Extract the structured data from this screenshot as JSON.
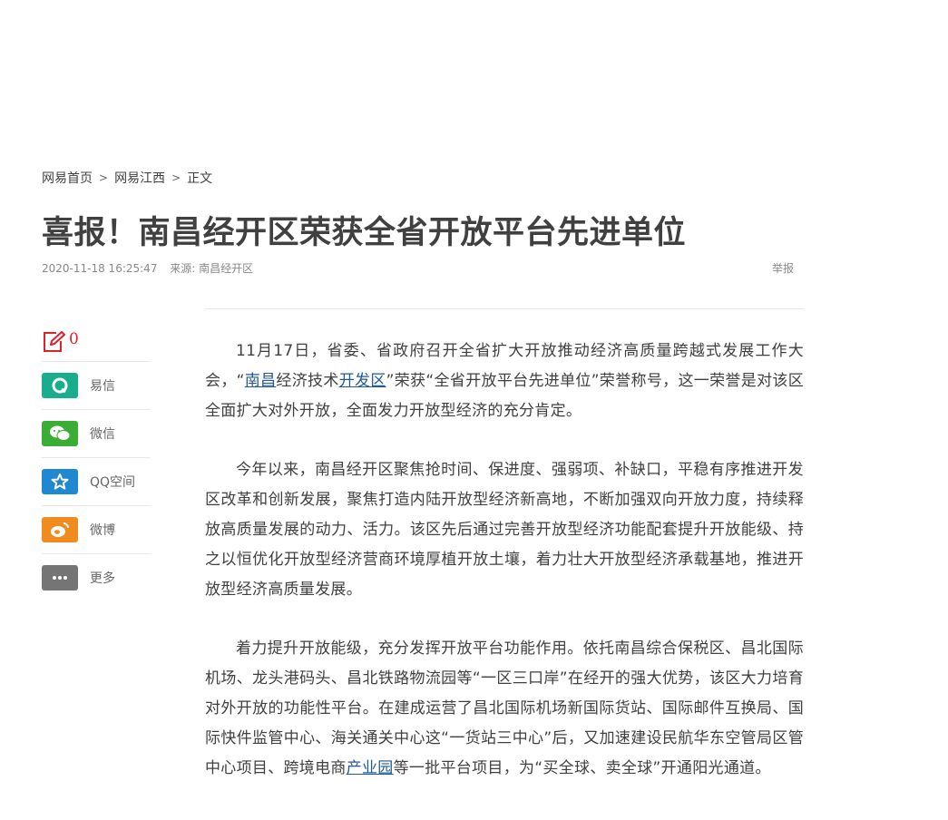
{
  "breadcrumb": {
    "home": "网易首页",
    "section": "网易江西",
    "current": "正文"
  },
  "article": {
    "title": "喜报！南昌经开区荣获全省开放平台先进单位",
    "datetime": "2020-11-18 16:25:47",
    "source": "来源: 南昌经开区",
    "report_label": "举报",
    "p1_a": "11月17日，省委、省政府召开全省扩大开放推动经济高质量跨越式发展工作大会，“",
    "p1_link1": "南昌",
    "p1_b": "经济技术",
    "p1_link2": "开发区",
    "p1_c": "”荣获“全省开放平台先进单位”荣誉称号，这一荣誉是对该区全面扩大对外开放，全面发力开放型经济的充分肯定。",
    "p2": "今年以来，南昌经开区聚焦抢时间、保进度、强弱项、补缺口，平稳有序推进开发区改革和创新发展，聚焦打造内陆开放型经济新高地，不断加强双向开放力度，持续释放高质量发展的动力、活力。该区先后通过完善开放型经济功能配套提升开放能级、持之以恒优化开放型经济营商环境厚植开放土壤，着力壮大开放型经济承载基地，推进开放型经济高质量发展。",
    "p3_a": "着力提升开放能级，充分发挥开放平台功能作用。依托南昌综合保税区、昌北国际机场、龙头港码头、昌北铁路物流园等“一区三口岸”在经开的强大优势，该区大力培育对外开放的功能性平台。在建成运营了昌北国际机场新国际货站、国际邮件互换局、国际快件监管中心、海关通关中心这“一货站三中心”后，又加速建设民航华东空管局区管中心项目、跨境电商",
    "p3_link": "产业园",
    "p3_b": "等一批平台项目，为“买全球、卖全球”开通阳光通道。"
  },
  "sidebar": {
    "comment_count": "0",
    "share": [
      {
        "label": "易信",
        "icon": "yixin-icon",
        "color": "#1aad8d"
      },
      {
        "label": "微信",
        "icon": "wechat-icon",
        "color": "#3aad36"
      },
      {
        "label": "QQ空间",
        "icon": "qzone-star-icon",
        "color": "#1f88d0"
      },
      {
        "label": "微博",
        "icon": "weibo-icon",
        "color": "#f08c1d"
      },
      {
        "label": "更多",
        "icon": "more-dots-icon",
        "color": "#757575"
      }
    ]
  },
  "colors": {
    "comment_red": "#e0202a",
    "link": "#1f5a96",
    "text": "#404040",
    "meta": "#888888"
  }
}
